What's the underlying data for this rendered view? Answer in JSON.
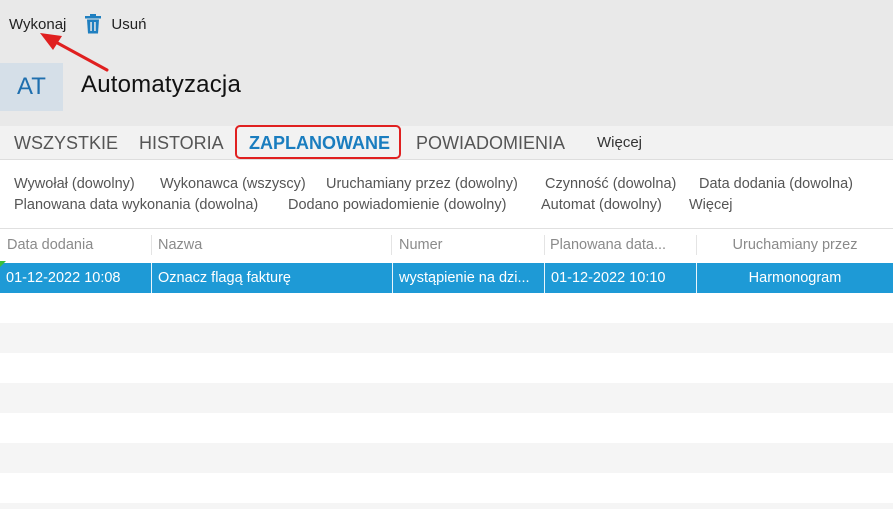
{
  "toolbar": {
    "run_label": "Wykonaj",
    "delete_label": "Usuń",
    "delete_icon": "trash-icon",
    "delete_icon_color": "#1f7fc0"
  },
  "header": {
    "badge": "AT",
    "title": "Automatyzacja"
  },
  "tabs": [
    {
      "label": "WSZYSTKIE"
    },
    {
      "label": "HISTORIA"
    },
    {
      "label": "ZAPLANOWANE",
      "active": true
    },
    {
      "label": "POWIADOMIENIA"
    },
    {
      "label": "Więcej"
    }
  ],
  "filters": [
    "Wywołał (dowolny)",
    "Wykonawca (wszyscy)",
    "Uruchamiany przez (dowolny)",
    "Czynność (dowolna)",
    "Data dodania (dowolna)",
    "Planowana data wykonania (dowolna)",
    "Dodano powiadomienie (dowolny)",
    "Automat (dowolny)",
    "Więcej"
  ],
  "grid": {
    "columns": [
      "Data dodania",
      "Nazwa",
      "Numer",
      "Planowana data...",
      "Uruchamiany przez"
    ],
    "rows": [
      [
        "01-12-2022 10:08",
        "Oznacz flagą fakturę",
        "wystąpienie na dzi...",
        "01-12-2022 10:10",
        "Harmonogram"
      ]
    ]
  },
  "colors": {
    "accent": "#1a7dbf",
    "selected_row": "#1e9ad6",
    "highlight": "#e02020"
  }
}
